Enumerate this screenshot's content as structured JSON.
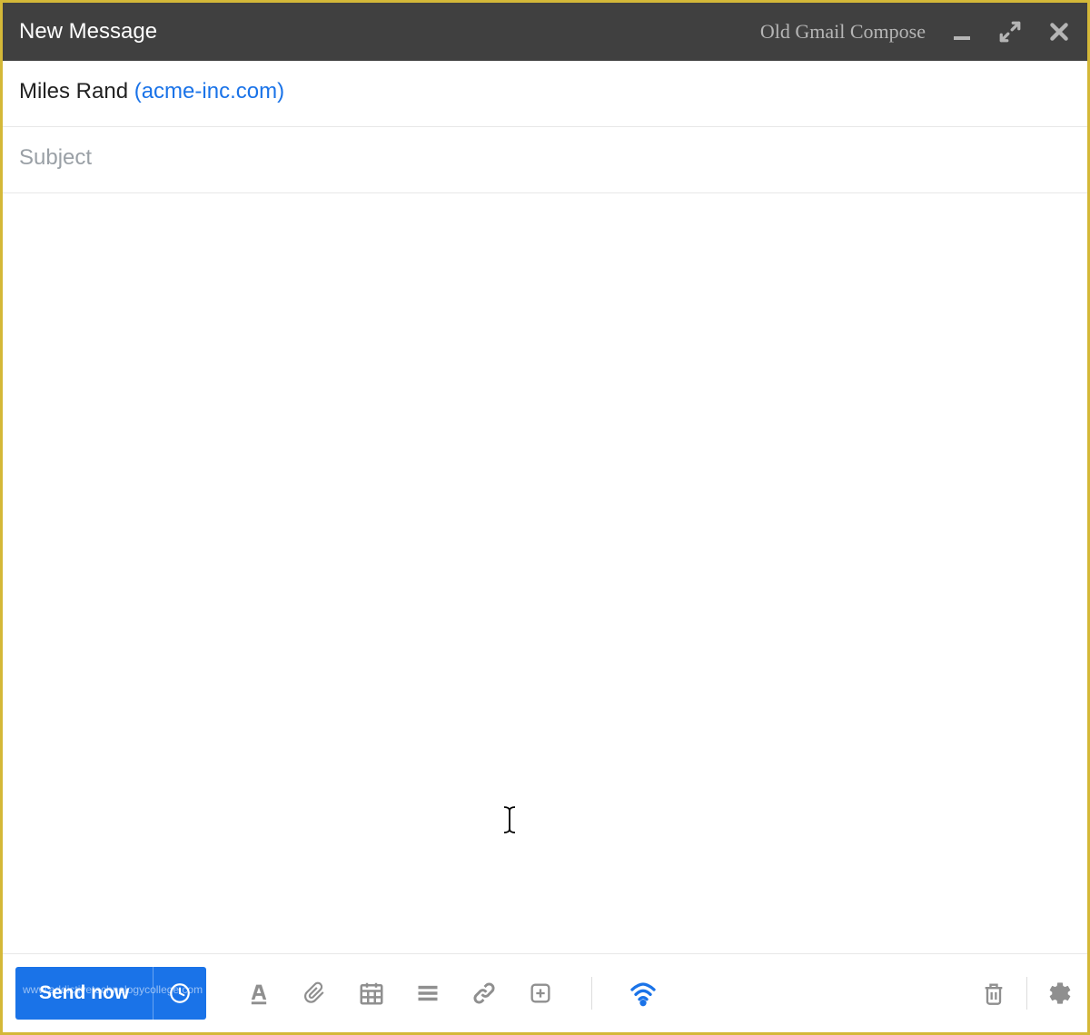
{
  "header": {
    "title": "New Message",
    "old_compose_label": "Old Gmail Compose"
  },
  "recipient": {
    "name": "Miles Rand ",
    "domain": "(acme-inc.com)"
  },
  "subject": {
    "placeholder": "Subject",
    "value": ""
  },
  "body": {
    "value": ""
  },
  "footer": {
    "send_label": "Send now"
  },
  "watermark": "www.addictivetechnologycollege.com"
}
